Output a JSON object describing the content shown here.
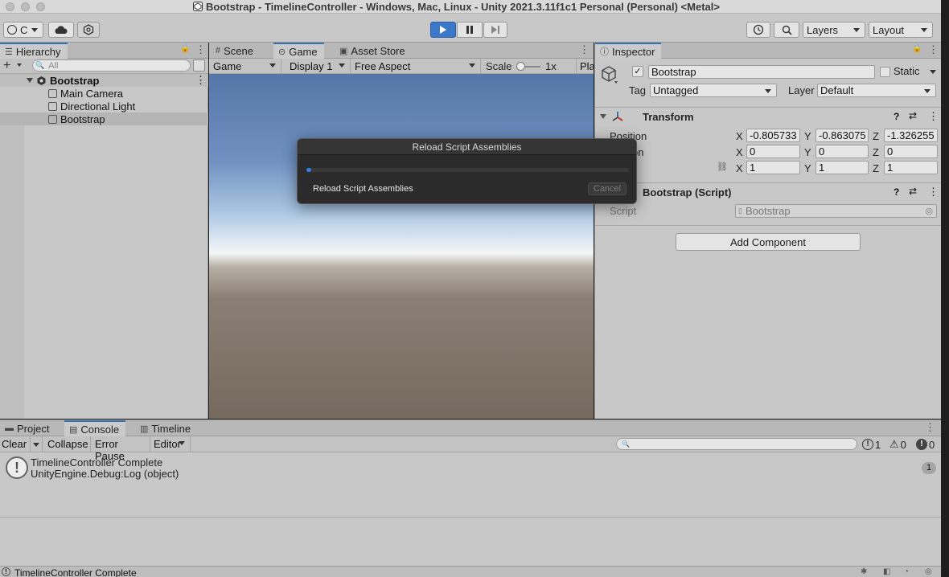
{
  "window": {
    "title": "Bootstrap - TimelineController - Windows, Mac, Linux - Unity 2021.3.11f1c1 Personal (Personal) <Metal>"
  },
  "toolbar": {
    "account_label": "C",
    "layers_label": "Layers",
    "layout_label": "Layout"
  },
  "hierarchy": {
    "tab_label": "Hierarchy",
    "search_placeholder": "All",
    "scene_name": "Bootstrap",
    "items": [
      {
        "label": "Main Camera"
      },
      {
        "label": "Directional Light"
      },
      {
        "label": "Bootstrap"
      }
    ]
  },
  "game": {
    "tabs": [
      {
        "label": "Scene"
      },
      {
        "label": "Game"
      },
      {
        "label": "Asset Store"
      }
    ],
    "display_mode": "Game",
    "display": "Display 1",
    "aspect": "Free Aspect",
    "scale_label": "Scale",
    "scale_value": "1x",
    "play_label": "Pla"
  },
  "dialog": {
    "title": "Reload Script Assemblies",
    "message": "Reload Script Assemblies",
    "cancel_label": "Cancel",
    "progress": 0.01
  },
  "inspector": {
    "tab_label": "Inspector",
    "object_name": "Bootstrap",
    "static_label": "Static",
    "tag_label": "Tag",
    "tag_value": "Untagged",
    "layer_label": "Layer",
    "layer_value": "Default",
    "transform": {
      "title": "Transform",
      "position_label": "Position",
      "rotation_label": "on",
      "position": {
        "x": "-0.805733",
        "y": "-0.863075",
        "z": "-1.326255"
      },
      "rotation": {
        "x": "0",
        "y": "0",
        "z": "0"
      },
      "scale": {
        "x": "1",
        "y": "1",
        "z": "1"
      },
      "axis_x": "X",
      "axis_y": "Y",
      "axis_z": "Z"
    },
    "script_component": {
      "title": "Bootstrap (Script)",
      "script_label": "Script",
      "script_value": "Bootstrap"
    },
    "add_component_label": "Add Component"
  },
  "bottom": {
    "tabs": [
      {
        "label": "Project"
      },
      {
        "label": "Console"
      },
      {
        "label": "Timeline"
      }
    ],
    "clear_label": "Clear",
    "collapse_label": "Collapse",
    "error_pause_label": "Error Pause",
    "editor_label": "Editor",
    "log_count": "1",
    "warn_count": "0",
    "error_count": "0",
    "log_line1": "TimelineController Complete",
    "log_line2": "UnityEngine.Debug:Log (object)",
    "entry_count": "1"
  },
  "status": {
    "message": "TimelineController Complete"
  }
}
